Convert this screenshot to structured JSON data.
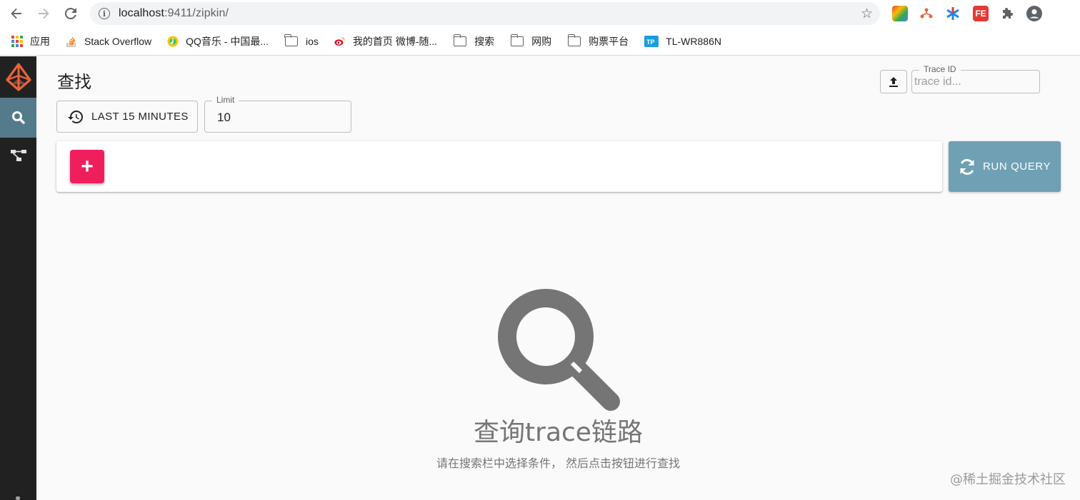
{
  "browser": {
    "url_host": "localhost",
    "url_rest": ":9411/zipkin/",
    "bookmarks": [
      {
        "label": "应用",
        "icon": "apps-grid-icon"
      },
      {
        "label": "Stack Overflow",
        "icon": "stackoverflow-icon"
      },
      {
        "label": "QQ音乐 - 中国最...",
        "icon": "qqmusic-icon"
      },
      {
        "label": "ios",
        "icon": "folder-icon"
      },
      {
        "label": "我的首页 微博-随...",
        "icon": "weibo-icon"
      },
      {
        "label": "搜索",
        "icon": "folder-icon"
      },
      {
        "label": "网购",
        "icon": "folder-icon"
      },
      {
        "label": "购票平台",
        "icon": "folder-icon"
      },
      {
        "label": "TL-WR886N",
        "icon": "tplink-icon"
      }
    ],
    "extensions": [
      {
        "name": "colorful-extension-icon"
      },
      {
        "name": "tree-extension-icon"
      },
      {
        "name": "asterisk-extension-icon"
      },
      {
        "name": "fe-extension-icon",
        "text": "FE"
      },
      {
        "name": "puzzle-icon"
      },
      {
        "name": "account-icon"
      }
    ]
  },
  "app": {
    "page_title": "查找",
    "lookback_label": "LAST 15 MINUTES",
    "limit": {
      "label": "Limit",
      "value": "10"
    },
    "trace_id": {
      "label": "Trace ID",
      "placeholder": "trace id..."
    },
    "add_label": "+",
    "run_query_label": "RUN QUERY",
    "empty_title": "查询trace链路",
    "empty_subtitle": "请在搜索栏中选择条件， 然后点击按钮进行查找",
    "colors": {
      "sidebar": "#212121",
      "sidebar_active": "#547b8b",
      "add_button": "#ef1f5e",
      "run_button": "#6fa0b4",
      "logo": "#e8643a"
    }
  },
  "watermark": "@稀土掘金技术社区"
}
